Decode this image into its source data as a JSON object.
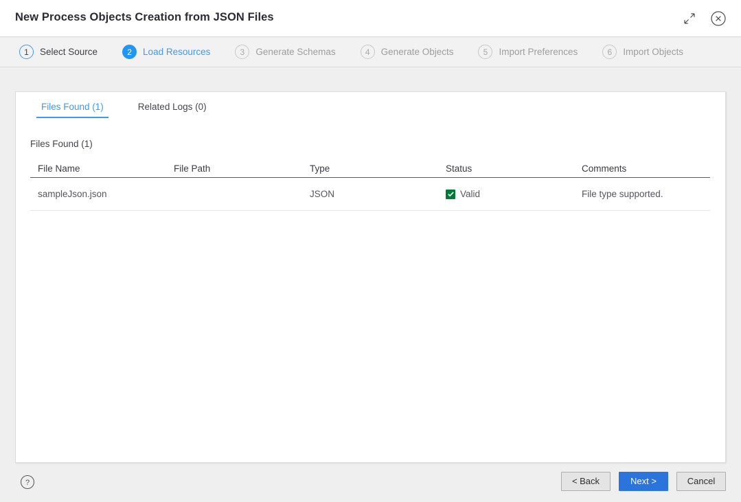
{
  "window": {
    "title": "New Process Objects Creation from JSON Files",
    "expand_icon": "expand-diagonal-icon",
    "close_icon": "close-circle-icon"
  },
  "stepper": {
    "steps": [
      {
        "number": "1",
        "label": "Select Source",
        "state": "done"
      },
      {
        "number": "2",
        "label": "Load Resources",
        "state": "active"
      },
      {
        "number": "3",
        "label": "Generate Schemas",
        "state": "todo"
      },
      {
        "number": "4",
        "label": "Generate Objects",
        "state": "todo"
      },
      {
        "number": "5",
        "label": "Import Preferences",
        "state": "todo"
      },
      {
        "number": "6",
        "label": "Import Objects",
        "state": "todo"
      }
    ]
  },
  "panel": {
    "tabs": [
      {
        "label": "Files Found (1)",
        "selected": true
      },
      {
        "label": "Related Logs (0)",
        "selected": false
      }
    ],
    "section_title": "Files Found (1)",
    "table": {
      "columns": [
        "File Name",
        "File Path",
        "Type",
        "Status",
        "Comments"
      ],
      "rows": [
        {
          "file_name": "sampleJson.json",
          "file_path": "",
          "type": "JSON",
          "status": "Valid",
          "status_checked": true,
          "comments": "File type supported."
        }
      ]
    }
  },
  "footer": {
    "help_icon": "help-circle-icon",
    "back_label": "< Back",
    "next_label": "Next >",
    "cancel_label": "Cancel"
  },
  "colors": {
    "accent_blue": "#3a9bf0",
    "step_active_blue": "#2196f3",
    "primary_button_blue": "#2a74dc",
    "valid_green": "#007b35",
    "page_background": "#efefef",
    "panel_background": "#ffffff"
  }
}
